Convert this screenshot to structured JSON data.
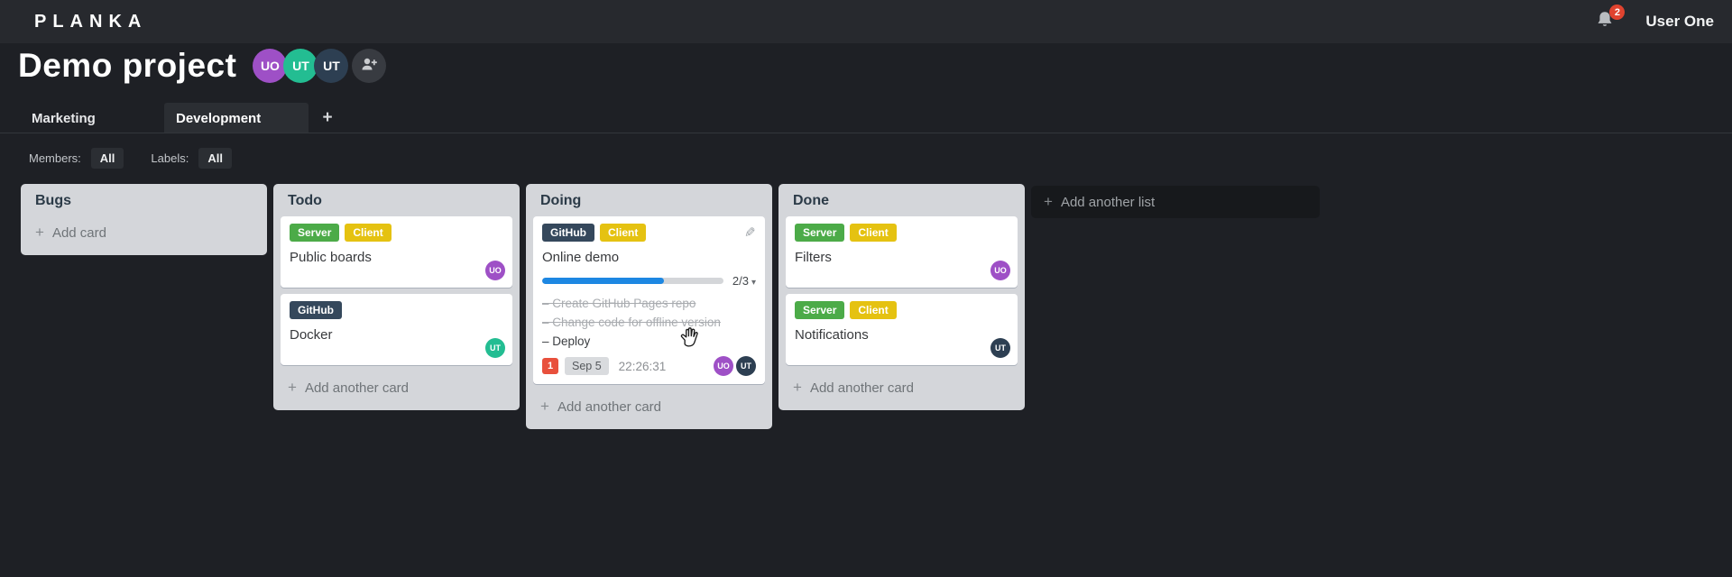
{
  "topbar": {
    "logo": "PLANKA",
    "user_name": "User One",
    "notification_count": "2"
  },
  "project": {
    "title": "Demo project",
    "members": [
      {
        "initials": "UO",
        "color": "#9e50c6"
      },
      {
        "initials": "UT",
        "color": "#23bd92"
      },
      {
        "initials": "UT",
        "color": "#2d3f52"
      }
    ]
  },
  "tabs": {
    "items": [
      {
        "label": "Marketing",
        "active": false
      },
      {
        "label": "Development",
        "active": true
      }
    ],
    "add_label": "+"
  },
  "filters": {
    "members_label": "Members:",
    "members_value": "All",
    "labels_label": "Labels:",
    "labels_value": "All"
  },
  "board": {
    "add_list_label": "Add another list",
    "lists": [
      {
        "title": "Bugs",
        "add_label": "Add card",
        "cards": []
      },
      {
        "title": "Todo",
        "add_label": "Add another card",
        "cards": [
          {
            "title": "Public boards",
            "labels": [
              {
                "text": "Server",
                "color": "#4cab48"
              },
              {
                "text": "Client",
                "color": "#e5c211"
              }
            ],
            "members": [
              {
                "initials": "UO",
                "color": "#9e50c6"
              }
            ]
          },
          {
            "title": "Docker",
            "labels": [
              {
                "text": "GitHub",
                "color": "#35485c"
              }
            ],
            "members": [
              {
                "initials": "UT",
                "color": "#23bd92"
              }
            ]
          }
        ]
      },
      {
        "title": "Doing",
        "add_label": "Add another card",
        "cards": [
          {
            "title": "Online demo",
            "editable": true,
            "labels": [
              {
                "text": "GitHub",
                "color": "#35485c"
              },
              {
                "text": "Client",
                "color": "#e5c211"
              }
            ],
            "progress": {
              "label": "2/3",
              "percent": 67,
              "color": "#1d87e2"
            },
            "tasks": [
              {
                "text": "Create GitHub Pages repo",
                "done": true
              },
              {
                "text": "Change code for offline version",
                "done": true
              },
              {
                "text": "Deploy",
                "done": false
              }
            ],
            "notification_count": "1",
            "due_date": "Sep 5",
            "timer": "22:26:31",
            "members": [
              {
                "initials": "UO",
                "color": "#9e50c6"
              },
              {
                "initials": "UT",
                "color": "#2d3f52"
              }
            ]
          }
        ]
      },
      {
        "title": "Done",
        "add_label": "Add another card",
        "cards": [
          {
            "title": "Filters",
            "labels": [
              {
                "text": "Server",
                "color": "#4cab48"
              },
              {
                "text": "Client",
                "color": "#e5c211"
              }
            ],
            "members": [
              {
                "initials": "UO",
                "color": "#9e50c6"
              }
            ]
          },
          {
            "title": "Notifications",
            "labels": [
              {
                "text": "Server",
                "color": "#4cab48"
              },
              {
                "text": "Client",
                "color": "#e5c211"
              }
            ],
            "members": [
              {
                "initials": "UT",
                "color": "#2d3f52"
              }
            ]
          }
        ]
      }
    ]
  }
}
